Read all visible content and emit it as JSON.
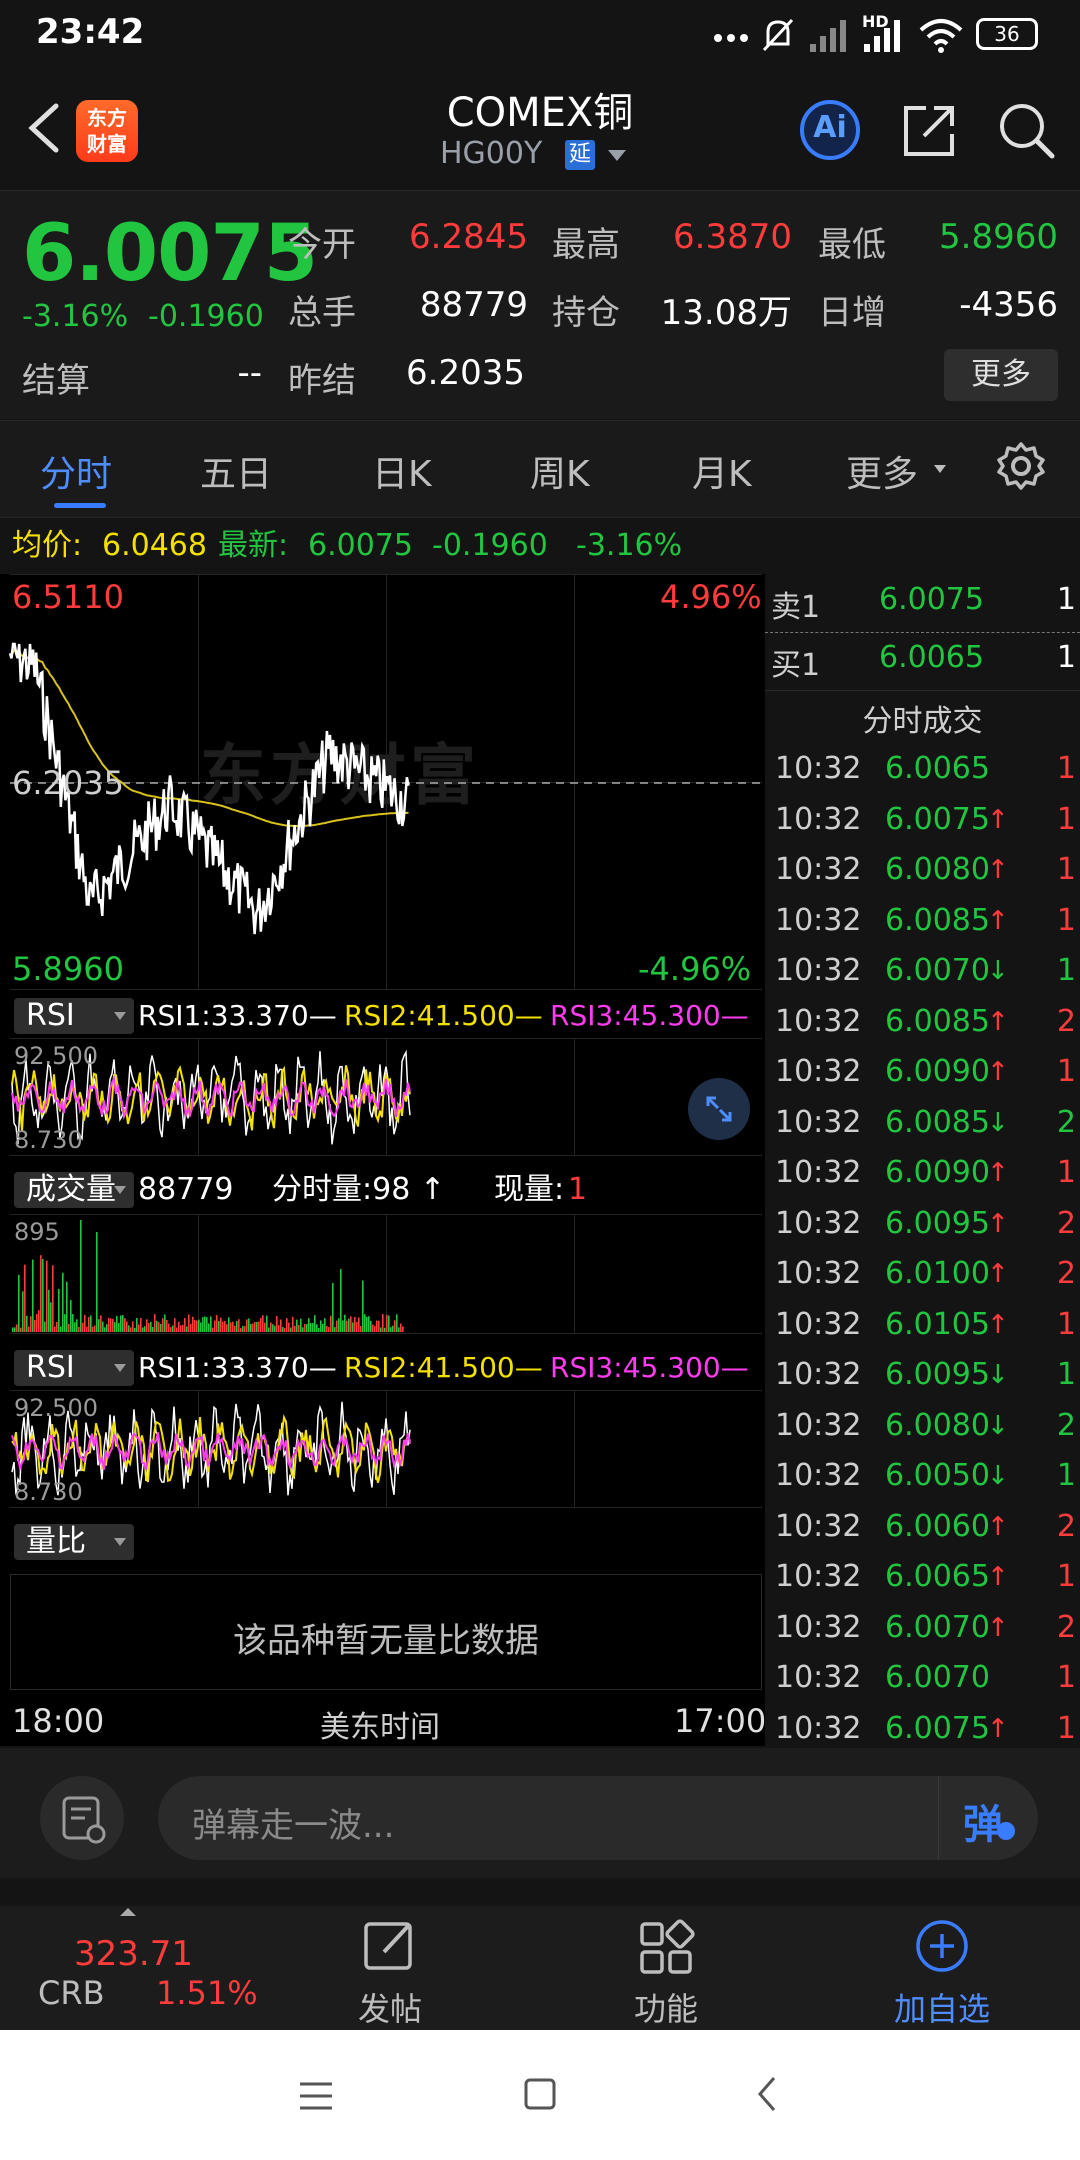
{
  "status": {
    "time": "23:42",
    "battery": "36",
    "network": "HD"
  },
  "header": {
    "logo_text": "东方财富",
    "logo_line1": "东方",
    "logo_line2": "财富",
    "title": "COMEX铜",
    "subtitle": "HG00Y",
    "delay_badge": "延",
    "ai_label": "Ai"
  },
  "quote": {
    "price": "6.0075",
    "change_pct": "-3.16%",
    "change_abs": "-0.1960",
    "rows": [
      [
        {
          "label": "今开",
          "value": "6.2845",
          "color": "red"
        },
        {
          "label": "最高",
          "value": "6.3870",
          "color": "red"
        },
        {
          "label": "最低",
          "value": "5.8960",
          "color": "green"
        }
      ],
      [
        {
          "label": "总手",
          "value": "88779",
          "color": "white"
        },
        {
          "label": "持仓",
          "value": "13.08万",
          "color": "white"
        },
        {
          "label": "日增",
          "value": "-4356",
          "color": "white"
        }
      ]
    ],
    "settle_label": "结算",
    "settle_value": "--",
    "prev_settle_label": "昨结",
    "prev_settle_value": "6.2035",
    "more_label": "更多"
  },
  "tabs": [
    "分时",
    "五日",
    "日K",
    "周K",
    "月K",
    "更多"
  ],
  "info_line": {
    "avg_label": "均价:",
    "avg_value": "6.0468",
    "latest_label": "最新:",
    "latest_value": "6.0075",
    "change_abs": "-0.1960",
    "change_pct": "-3.16%"
  },
  "chart": {
    "price_high": "6.5110",
    "price_low": "5.8960",
    "pct_high": "4.96%",
    "pct_low": "-4.96%",
    "prev_close_label": "6.2035",
    "watermark": "东方财富",
    "rsi_select": "RSI",
    "rsi1": "RSI1:33.370—",
    "rsi2": "RSI2:41.500—",
    "rsi3": "RSI3:45.300—",
    "rsi_max": "92.500",
    "rsi_min": "8.730",
    "vol_select": "成交量",
    "vol_total": "88779",
    "vol_period": "分时量:98 ↑",
    "vol_now_label": "现量:",
    "vol_now_value": "1",
    "vol_max": "895",
    "ratio_select": "量比",
    "ratio_empty": "该品种暂无量比数据",
    "time_start": "18:00",
    "time_zone": "美东时间",
    "time_end": "17:00"
  },
  "ticks": {
    "ask_label": "卖1",
    "ask_price": "6.0075",
    "ask_vol": "1",
    "bid_label": "买1",
    "bid_price": "6.0065",
    "bid_vol": "1",
    "title": "分时成交",
    "rows": [
      {
        "time": "10:32",
        "price": "6.0065",
        "dir": "",
        "vol": "1"
      },
      {
        "time": "10:32",
        "price": "6.0075",
        "dir": "↑",
        "vol": "1"
      },
      {
        "time": "10:32",
        "price": "6.0080",
        "dir": "↑",
        "vol": "1"
      },
      {
        "time": "10:32",
        "price": "6.0085",
        "dir": "↑",
        "vol": "1"
      },
      {
        "time": "10:32",
        "price": "6.0070",
        "dir": "↓",
        "vol": "1"
      },
      {
        "time": "10:32",
        "price": "6.0085",
        "dir": "↑",
        "vol": "2"
      },
      {
        "time": "10:32",
        "price": "6.0090",
        "dir": "↑",
        "vol": "1"
      },
      {
        "time": "10:32",
        "price": "6.0085",
        "dir": "↓",
        "vol": "2"
      },
      {
        "time": "10:32",
        "price": "6.0090",
        "dir": "↑",
        "vol": "1"
      },
      {
        "time": "10:32",
        "price": "6.0095",
        "dir": "↑",
        "vol": "2"
      },
      {
        "time": "10:32",
        "price": "6.0100",
        "dir": "↑",
        "vol": "2"
      },
      {
        "time": "10:32",
        "price": "6.0105",
        "dir": "↑",
        "vol": "1"
      },
      {
        "time": "10:32",
        "price": "6.0095",
        "dir": "↓",
        "vol": "1"
      },
      {
        "time": "10:32",
        "price": "6.0080",
        "dir": "↓",
        "vol": "2"
      },
      {
        "time": "10:32",
        "price": "6.0050",
        "dir": "↓",
        "vol": "1"
      },
      {
        "time": "10:32",
        "price": "6.0060",
        "dir": "↑",
        "vol": "2"
      },
      {
        "time": "10:32",
        "price": "6.0065",
        "dir": "↑",
        "vol": "1"
      },
      {
        "time": "10:32",
        "price": "6.0070",
        "dir": "↑",
        "vol": "2"
      },
      {
        "time": "10:32",
        "price": "6.0070",
        "dir": "",
        "vol": "1"
      },
      {
        "time": "10:32",
        "price": "6.0075",
        "dir": "↑",
        "vol": "1"
      }
    ]
  },
  "comment": {
    "placeholder": "弹幕走一波...",
    "danmu_label": "弹"
  },
  "bottom_nav": {
    "crb_value": "323.71",
    "crb_label": "CRB",
    "crb_pct": "1.51%",
    "post_label": "发帖",
    "func_label": "功能",
    "add_label": "加自选"
  },
  "colors": {
    "red": "#ff3b3b",
    "green": "#21c540",
    "yellow": "#f3e000",
    "magenta": "#ff3cf0",
    "accent": "#3a7cff"
  }
}
